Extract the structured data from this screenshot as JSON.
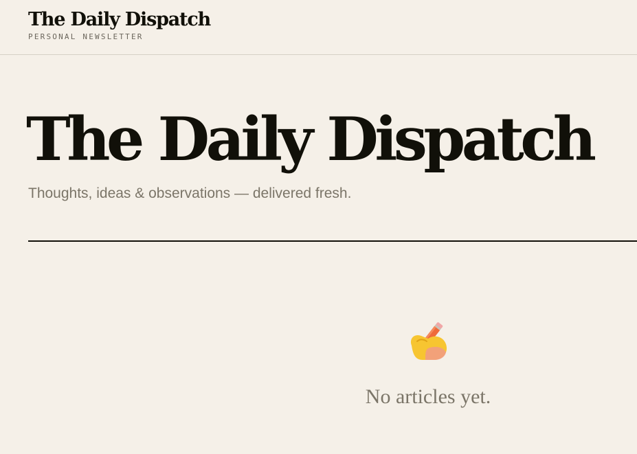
{
  "header": {
    "brand_title": "The Daily Dispatch",
    "brand_subtitle": "PERSONAL NEWSLETTER"
  },
  "hero": {
    "title": "The Daily Dispatch",
    "tagline": "Thoughts, ideas & observations — delivered fresh."
  },
  "empty_state": {
    "icon": "writing-hand-icon",
    "message": "No articles yet."
  },
  "colors": {
    "background": "#f5f0e8",
    "ink": "#111009",
    "muted": "#7b7568",
    "divider": "#d6d0c6"
  }
}
